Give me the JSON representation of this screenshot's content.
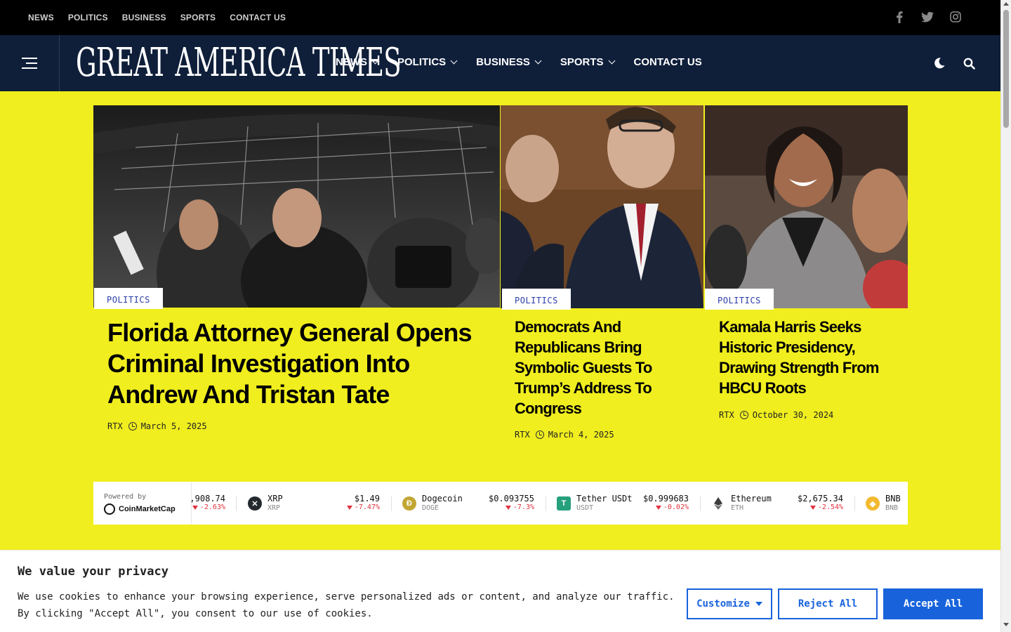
{
  "topbar": {
    "links": [
      "NEWS",
      "POLITICS",
      "BUSINESS",
      "SPORTS",
      "CONTACT US"
    ],
    "social": [
      "facebook-icon",
      "twitter-icon",
      "instagram-icon"
    ]
  },
  "header": {
    "logo": "GREAT AMERICA TIMES",
    "menu": [
      {
        "label": "NEWS"
      },
      {
        "label": "POLITICS"
      },
      {
        "label": "BUSINESS"
      },
      {
        "label": "SPORTS"
      },
      {
        "label": "CONTACT US"
      }
    ],
    "tools": [
      "dark-mode-icon",
      "search-icon"
    ]
  },
  "featured": {
    "main": {
      "category": "POLITICS",
      "title": "Florida Attorney General Opens Criminal Investigation Into Andrew And Tristan Tate",
      "author": "RTX",
      "date": "March 5, 2025"
    },
    "second": {
      "category": "POLITICS",
      "title": "Democrats And Republicans Bring Symbolic Guests To Trump’s Address To Congress",
      "author": "RTX",
      "date": "March 4, 2025"
    },
    "third": {
      "category": "POLITICS",
      "title": "Kamala Harris Seeks Historic Presidency, Drawing Strength From HBCU Roots",
      "author": "RTX",
      "date": "October 30, 2024"
    }
  },
  "ticker": {
    "powered_by": "Powered by",
    "brand": "CoinMarketCap",
    "coins": [
      {
        "name": "",
        "symbol": "",
        "price": ",908.74",
        "change": "-2.63%"
      },
      {
        "name": "XRP",
        "symbol": "XRP",
        "price": "$1.49",
        "change": "-7.47%",
        "color": "#23292f"
      },
      {
        "name": "Dogecoin",
        "symbol": "DOGE",
        "price": "$0.093755",
        "change": "-7.3%",
        "color": "#c2a633"
      },
      {
        "name": "Tether USDt",
        "symbol": "USDT",
        "price": "$0.999683",
        "change": "-0.02%",
        "color": "#26a17b"
      },
      {
        "name": "Ethereum",
        "symbol": "ETH",
        "price": "$2,675.34",
        "change": "-2.54%",
        "color": "#3c3c3d"
      },
      {
        "name": "BNB",
        "symbol": "BNB",
        "price": "",
        "change": "",
        "color": "#f3ba2f"
      }
    ]
  },
  "cookie": {
    "heading": "We value your privacy",
    "text": "We use cookies to enhance your browsing experience, serve personalized ads or content, and analyze our traffic. By clicking \"Accept All\", you consent to our use of cookies.",
    "customize": "Customize",
    "reject": "Reject All",
    "accept": "Accept All",
    "accent": "#1863dc"
  }
}
